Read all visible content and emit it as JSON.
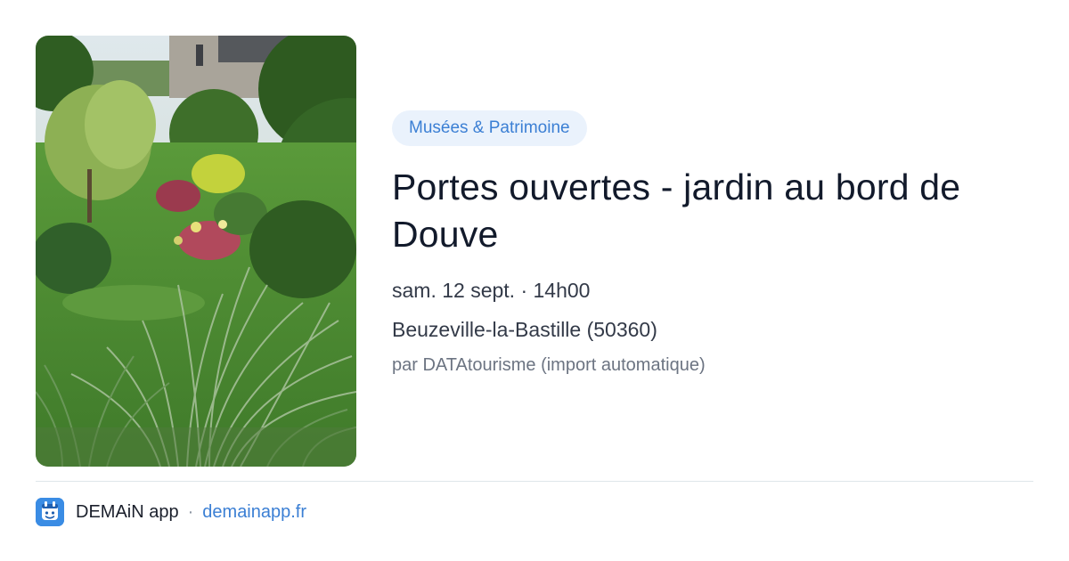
{
  "event": {
    "category": "Musées & Patrimoine",
    "title": "Portes ouvertes - jardin au bord de Douve",
    "datetime": "sam. 12 sept. · 14h00",
    "location": "Beuzeville-la-Bastille (50360)",
    "author": "par DATAtourisme (import automatique)",
    "image_subject": "garden with ornamental grasses and stone chapel"
  },
  "footer": {
    "app_icon": "demain-app-icon",
    "app_name": "DEMAiN app",
    "separator": "·",
    "site": "demainapp.fr"
  },
  "colors": {
    "accent": "#3b7fd4",
    "badge_bg": "#eaf2fc",
    "title": "#121a2b",
    "muted": "#6c7482",
    "divider": "#dfe6ea"
  }
}
